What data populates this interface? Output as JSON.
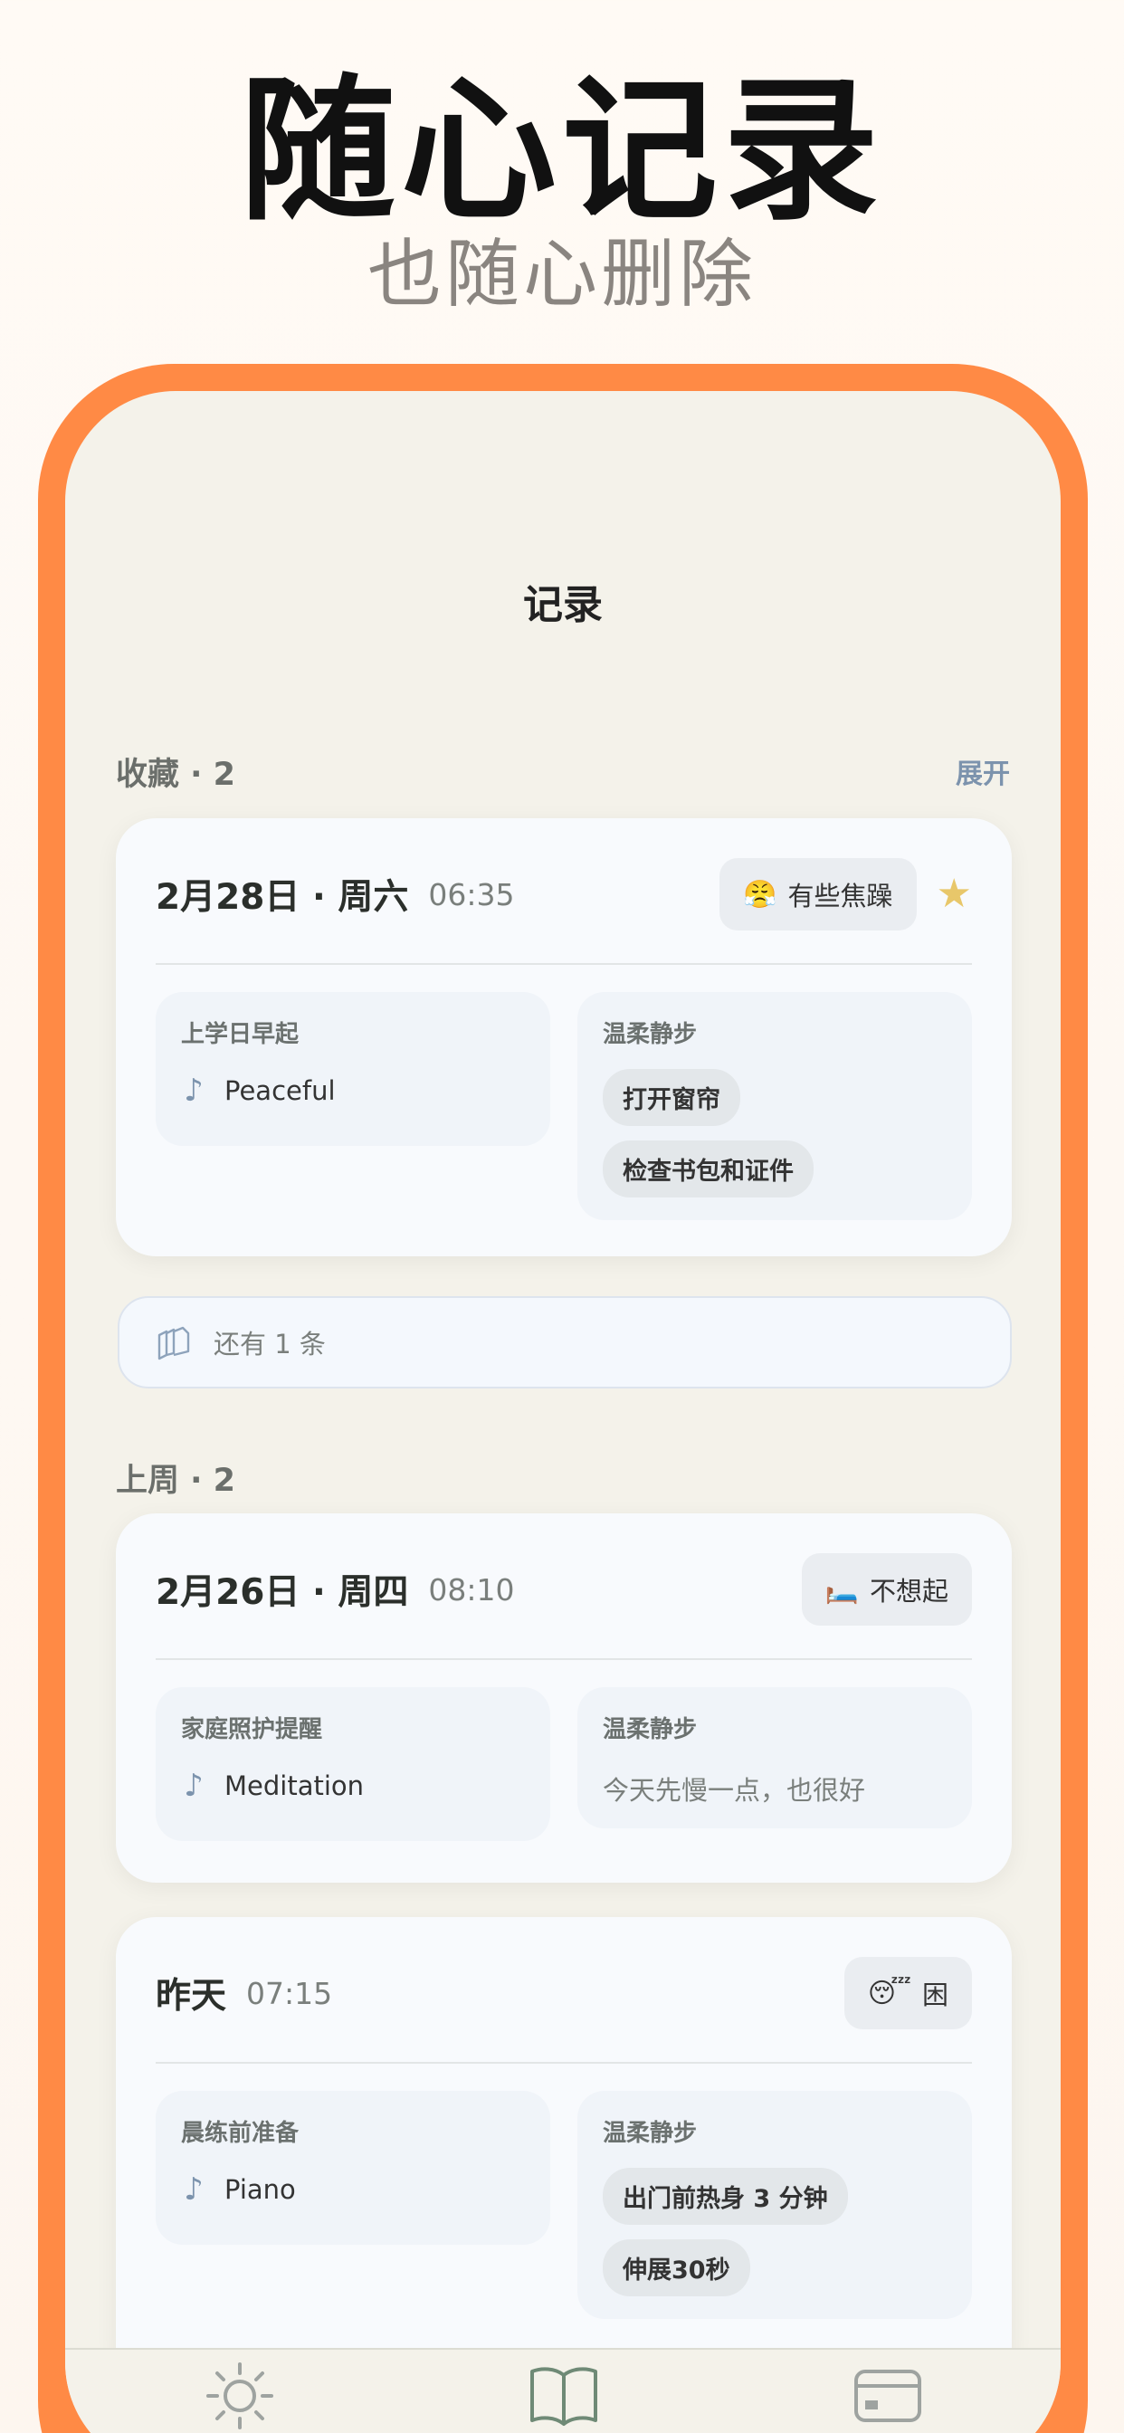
{
  "hero": {
    "title": "随心记录",
    "subtitle": "也随心删除"
  },
  "screen": {
    "title": "记录"
  },
  "favorites": {
    "label": "收藏 · 2",
    "expand_label": "展开",
    "more_label": "还有 1 条"
  },
  "last_week": {
    "label": "上周 · 2"
  },
  "entries": [
    {
      "date": "2月28日 · 周六",
      "time": "06:35",
      "mood_emoji": "😤",
      "mood_label": "有些焦躁",
      "starred": true,
      "routine_title": "上学日早起",
      "music": "Peaceful",
      "walk_title": "温柔静步",
      "tasks": [
        "打开窗帘",
        "检查书包和证件"
      ]
    },
    {
      "date": "2月26日 · 周四",
      "time": "08:10",
      "mood_emoji": "🛏️",
      "mood_label": "不想起",
      "routine_title": "家庭照护提醒",
      "music": "Meditation",
      "walk_title": "温柔静步",
      "note": "今天先慢一点，也很好"
    },
    {
      "date": "昨天",
      "time": "07:15",
      "mood_emoji": "😴",
      "mood_label": "困",
      "routine_title": "晨练前准备",
      "music": "Piano",
      "walk_title": "温柔静步",
      "tasks": [
        "出门前热身 3 分钟",
        "伸展30秒"
      ]
    }
  ],
  "colors": {
    "accent": "#ff8a45",
    "star": "#e8c76a",
    "link": "#7c93ad",
    "tab_active": "#6f8a76",
    "tab_inactive": "#9ea3a0"
  },
  "tabs": [
    {
      "icon": "sun-icon",
      "active": false
    },
    {
      "icon": "book-icon",
      "active": true
    },
    {
      "icon": "card-icon",
      "active": false
    }
  ]
}
